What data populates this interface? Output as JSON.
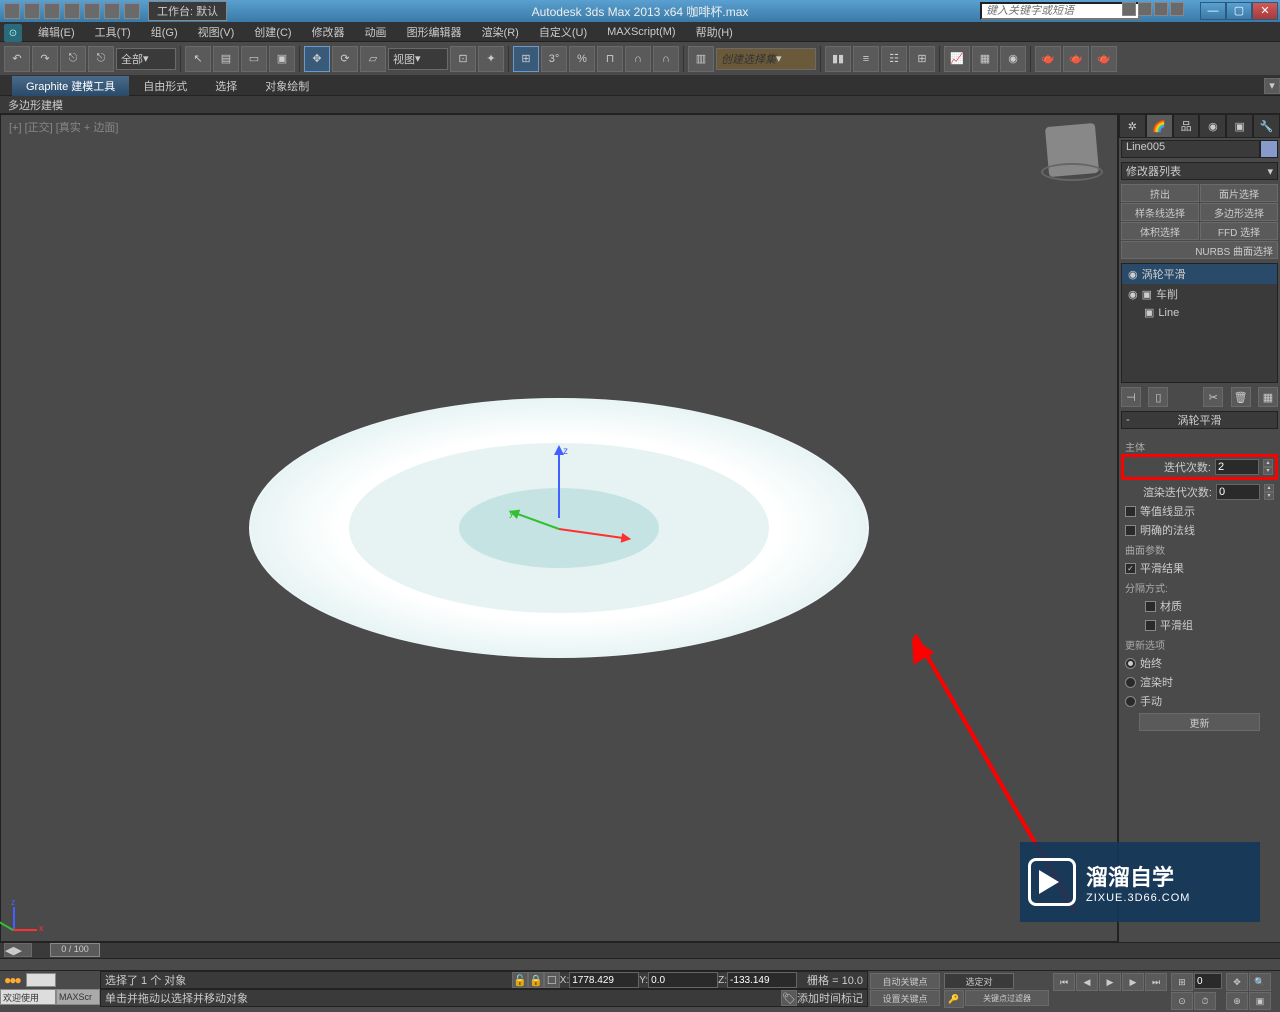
{
  "titlebar": {
    "workspace": "工作台: 默认",
    "app_title": "Autodesk 3ds Max  2013 x64    咖啡杯.max",
    "search_placeholder": "键入关键字或短语"
  },
  "menubar": {
    "items": [
      "编辑(E)",
      "工具(T)",
      "组(G)",
      "视图(V)",
      "创建(C)",
      "修改器",
      "动画",
      "图形编辑器",
      "渲染(R)",
      "自定义(U)",
      "MAXScript(M)",
      "帮助(H)"
    ]
  },
  "ribbon": {
    "tabs": [
      "Graphite 建模工具",
      "自由形式",
      "选择",
      "对象绘制"
    ],
    "active": 0,
    "sub_label": "多边形建模"
  },
  "main_toolbar": {
    "filter_all": "全部",
    "view_dropdown": "视图",
    "create_set_placeholder": "创建选择集"
  },
  "viewport": {
    "label_prefix": "[+] [正交] ",
    "label_mode": "[真实 + 边面]"
  },
  "command_panel": {
    "object_name": "Line005",
    "modifier_list_label": "修改器列表",
    "buttons": [
      "挤出",
      "面片选择",
      "样条线选择",
      "多边形选择",
      "体积选择",
      "FFD 选择",
      "NURBS 曲面选择"
    ],
    "stack": [
      {
        "label": "涡轮平滑",
        "selected": true,
        "bulb": true,
        "expand": false
      },
      {
        "label": "车削",
        "selected": false,
        "bulb": true,
        "expand": true
      },
      {
        "label": "Line",
        "selected": false,
        "bulb": false,
        "expand": true
      }
    ],
    "rollout_title": "涡轮平滑",
    "params": {
      "main_group": "主体",
      "iterations_label": "迭代次数:",
      "iterations_value": "2",
      "render_iters_label": "渲染迭代次数:",
      "render_iters_value": "0",
      "isoline_label": "等值线显示",
      "isoline_checked": false,
      "explicit_normals_label": "明确的法线",
      "explicit_normals_checked": false,
      "surface_group": "曲面参数",
      "smooth_result_label": "平滑结果",
      "smooth_result_checked": true,
      "separate_label": "分隔方式:",
      "material_label": "材质",
      "material_checked": false,
      "smooth_group_label": "平滑组",
      "smooth_group_checked": false,
      "update_group": "更新选项",
      "always_label": "始终",
      "render_label": "渲染时",
      "manual_label": "手动",
      "update_radio": "always",
      "update_btn": "更新"
    }
  },
  "timeline": {
    "slider_value": "0 / 100"
  },
  "status": {
    "welcome": "欢迎使用",
    "tab": "MAXScr",
    "line1": "选择了 1 个 对象",
    "line2": "单击并拖动以选择并移动对象",
    "coords": {
      "x_label": "X:",
      "x": "1778.429",
      "y_label": "Y:",
      "y": "0.0",
      "z_label": "Z:",
      "z": "-133.149"
    },
    "grid": "栅格 = 10.0",
    "autokey": "自动关键点",
    "setkey": "设置关键点",
    "selected_set": "选定对",
    "key_filter": "关键点过滤器",
    "add_time_tag": "添加时间标记"
  },
  "watermark": {
    "title": "溜溜自学",
    "url": "ZIXUE.3D66.COM"
  }
}
